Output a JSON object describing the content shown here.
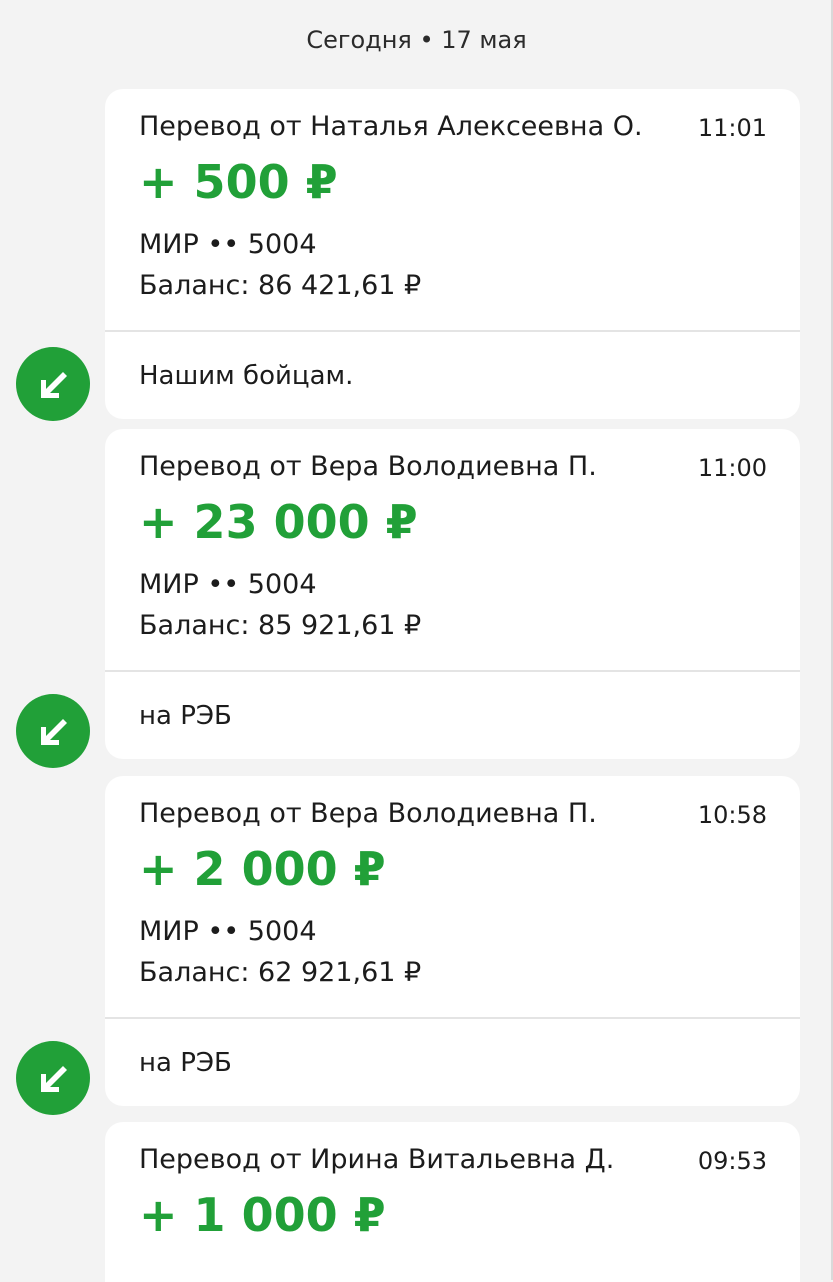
{
  "header": {
    "date": "Сегодня • 17 мая"
  },
  "messages": [
    {
      "title": "Перевод от Наталья Алексеевна О.",
      "time": "11:01",
      "amount": "+ 500 ₽",
      "card": "МИР •• 5004",
      "balance": "Баланс: 86 421,61 ₽",
      "comment": "Нашим бойцам."
    },
    {
      "title": "Перевод от Вера Володиевна П.",
      "time": "11:00",
      "amount": "+ 23 000 ₽",
      "card": "МИР •• 5004",
      "balance": "Баланс: 85 921,61 ₽",
      "comment": "на РЭБ"
    },
    {
      "title": "Перевод от Вера Володиевна П.",
      "time": "10:58",
      "amount": "+ 2 000 ₽",
      "card": "МИР •• 5004",
      "balance": "Баланс: 62 921,61 ₽",
      "comment": "на РЭБ"
    },
    {
      "title": "Перевод от Ирина Витальевна Д.",
      "time": "09:53",
      "amount": "+ 1 000 ₽"
    }
  ],
  "icons": {
    "incoming": "arrow-down-left-icon"
  },
  "colors": {
    "accent": "#21a038",
    "background": "#f3f3f3",
    "card": "#ffffff"
  }
}
